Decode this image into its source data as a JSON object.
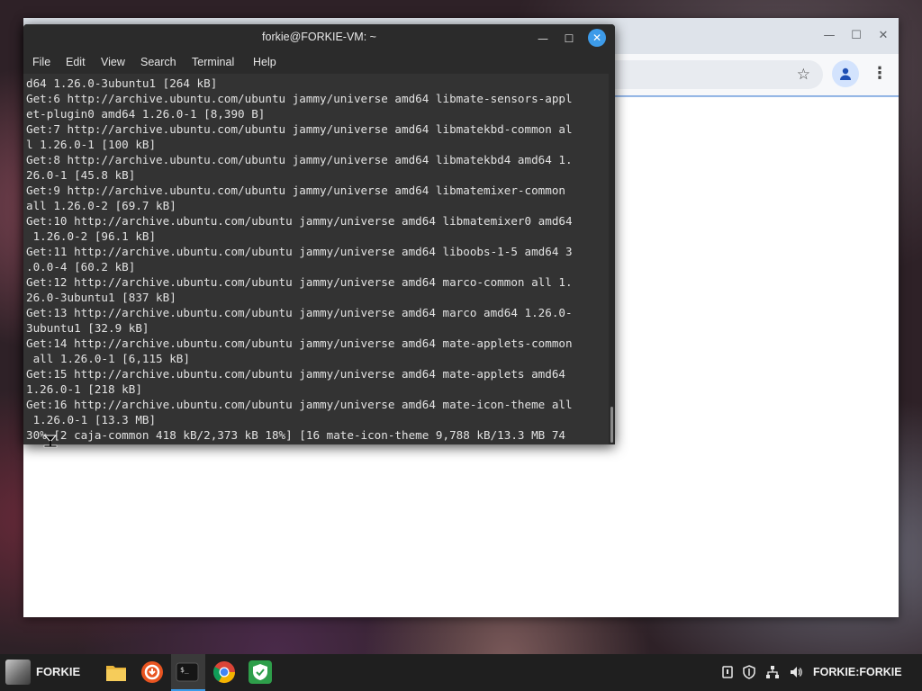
{
  "browser": {
    "window_controls": {
      "minimize": "—",
      "maximize": "☐",
      "close": "✕"
    }
  },
  "terminal": {
    "title": "forkie@FORKIE-VM: ~",
    "menu": [
      "File",
      "Edit",
      "View",
      "Search",
      "Terminal",
      "Help"
    ],
    "lines": [
      "d64 1.26.0-3ubuntu1 [264 kB]",
      "Get:6 http://archive.ubuntu.com/ubuntu jammy/universe amd64 libmate-sensors-appl",
      "et-plugin0 amd64 1.26.0-1 [8,390 B]",
      "Get:7 http://archive.ubuntu.com/ubuntu jammy/universe amd64 libmatekbd-common al",
      "l 1.26.0-1 [100 kB]",
      "Get:8 http://archive.ubuntu.com/ubuntu jammy/universe amd64 libmatekbd4 amd64 1.",
      "26.0-1 [45.8 kB]",
      "Get:9 http://archive.ubuntu.com/ubuntu jammy/universe amd64 libmatemixer-common",
      "all 1.26.0-2 [69.7 kB]",
      "Get:10 http://archive.ubuntu.com/ubuntu jammy/universe amd64 libmatemixer0 amd64",
      " 1.26.0-2 [96.1 kB]",
      "Get:11 http://archive.ubuntu.com/ubuntu jammy/universe amd64 liboobs-1-5 amd64 3",
      ".0.0-4 [60.2 kB]",
      "Get:12 http://archive.ubuntu.com/ubuntu jammy/universe amd64 marco-common all 1.",
      "26.0-3ubuntu1 [837 kB]",
      "Get:13 http://archive.ubuntu.com/ubuntu jammy/universe amd64 marco amd64 1.26.0-",
      "3ubuntu1 [32.9 kB]",
      "Get:14 http://archive.ubuntu.com/ubuntu jammy/universe amd64 mate-applets-common",
      " all 1.26.0-1 [6,115 kB]",
      "Get:15 http://archive.ubuntu.com/ubuntu jammy/universe amd64 mate-applets amd64",
      "1.26.0-1 [218 kB]",
      "Get:16 http://archive.ubuntu.com/ubuntu jammy/universe amd64 mate-icon-theme all",
      " 1.26.0-1 [13.3 MB]",
      "30% [2 caja-common 418 kB/2,373 kB 18%] [16 mate-icon-theme 9,788 kB/13.3 MB 74"
    ],
    "window_controls": {
      "minimize": "—",
      "maximize": "☐",
      "close": "✕"
    }
  },
  "taskbar": {
    "start_label": "FORKIE",
    "apps": [
      {
        "icon": "folder-icon"
      },
      {
        "icon": "app-installer-icon"
      },
      {
        "icon": "terminal-icon",
        "active": true
      },
      {
        "icon": "chrome-icon"
      },
      {
        "icon": "shield-app-icon"
      }
    ],
    "user_label": "FORKIE:FORKIE"
  }
}
